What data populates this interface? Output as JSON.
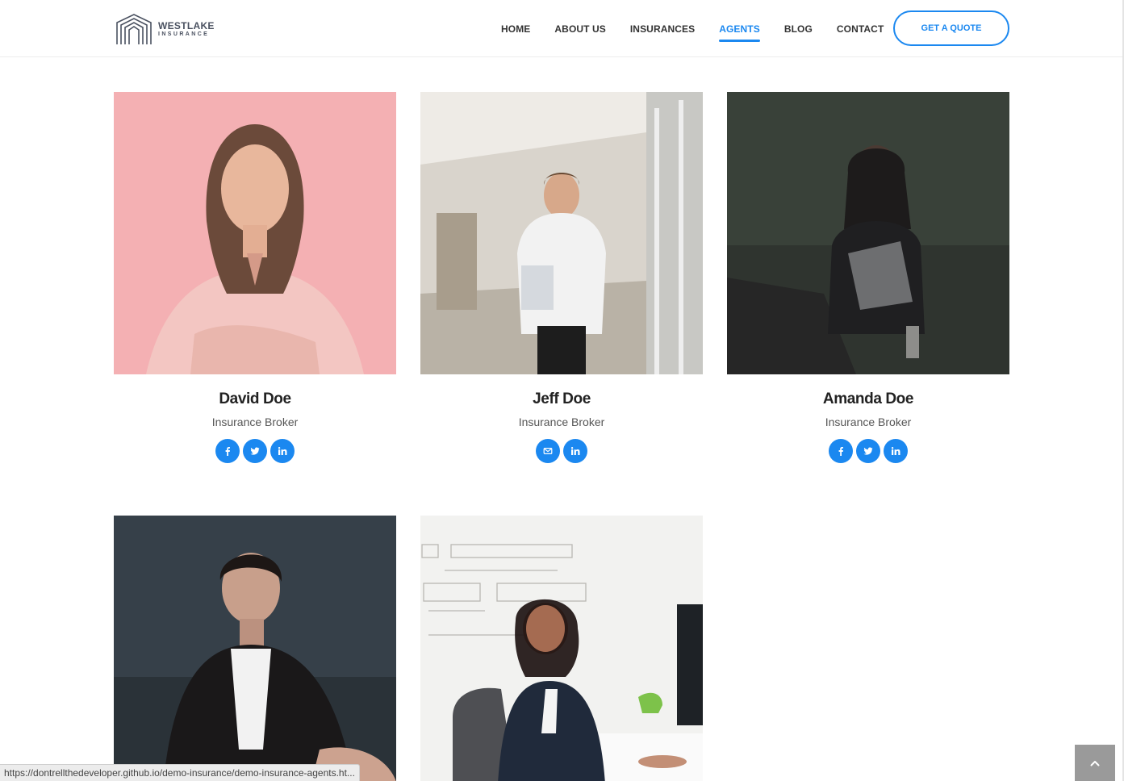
{
  "brand": {
    "name": "WESTLAKE",
    "subtitle": "INSURANCE"
  },
  "nav": {
    "items": [
      {
        "label": "HOME"
      },
      {
        "label": "ABOUT US"
      },
      {
        "label": "INSURANCES"
      },
      {
        "label": "AGENTS",
        "active": true
      },
      {
        "label": "BLOG"
      },
      {
        "label": "CONTACT"
      }
    ],
    "cta_label": "GET A QUOTE"
  },
  "agents": [
    {
      "name": "David Doe",
      "role": "Insurance Broker",
      "socials": [
        "facebook-icon",
        "twitter-icon",
        "linkedin-icon"
      ]
    },
    {
      "name": "Jeff Doe",
      "role": "Insurance Broker",
      "socials": [
        "envelope-icon",
        "linkedin-icon"
      ]
    },
    {
      "name": "Amanda Doe",
      "role": "Insurance Broker",
      "socials": [
        "facebook-icon",
        "twitter-icon",
        "linkedin-icon"
      ]
    },
    {
      "name": "",
      "role": "",
      "socials": []
    },
    {
      "name": "",
      "role": "",
      "socials": []
    }
  ],
  "status_bar": {
    "url": "https://dontrellthedeveloper.github.io/demo-insurance/demo-insurance-agents.ht..."
  },
  "colors": {
    "accent": "#1b88f0",
    "back_to_top": "#9a9a9a"
  },
  "icons": {
    "back_to_top": "chevron-up-icon"
  }
}
